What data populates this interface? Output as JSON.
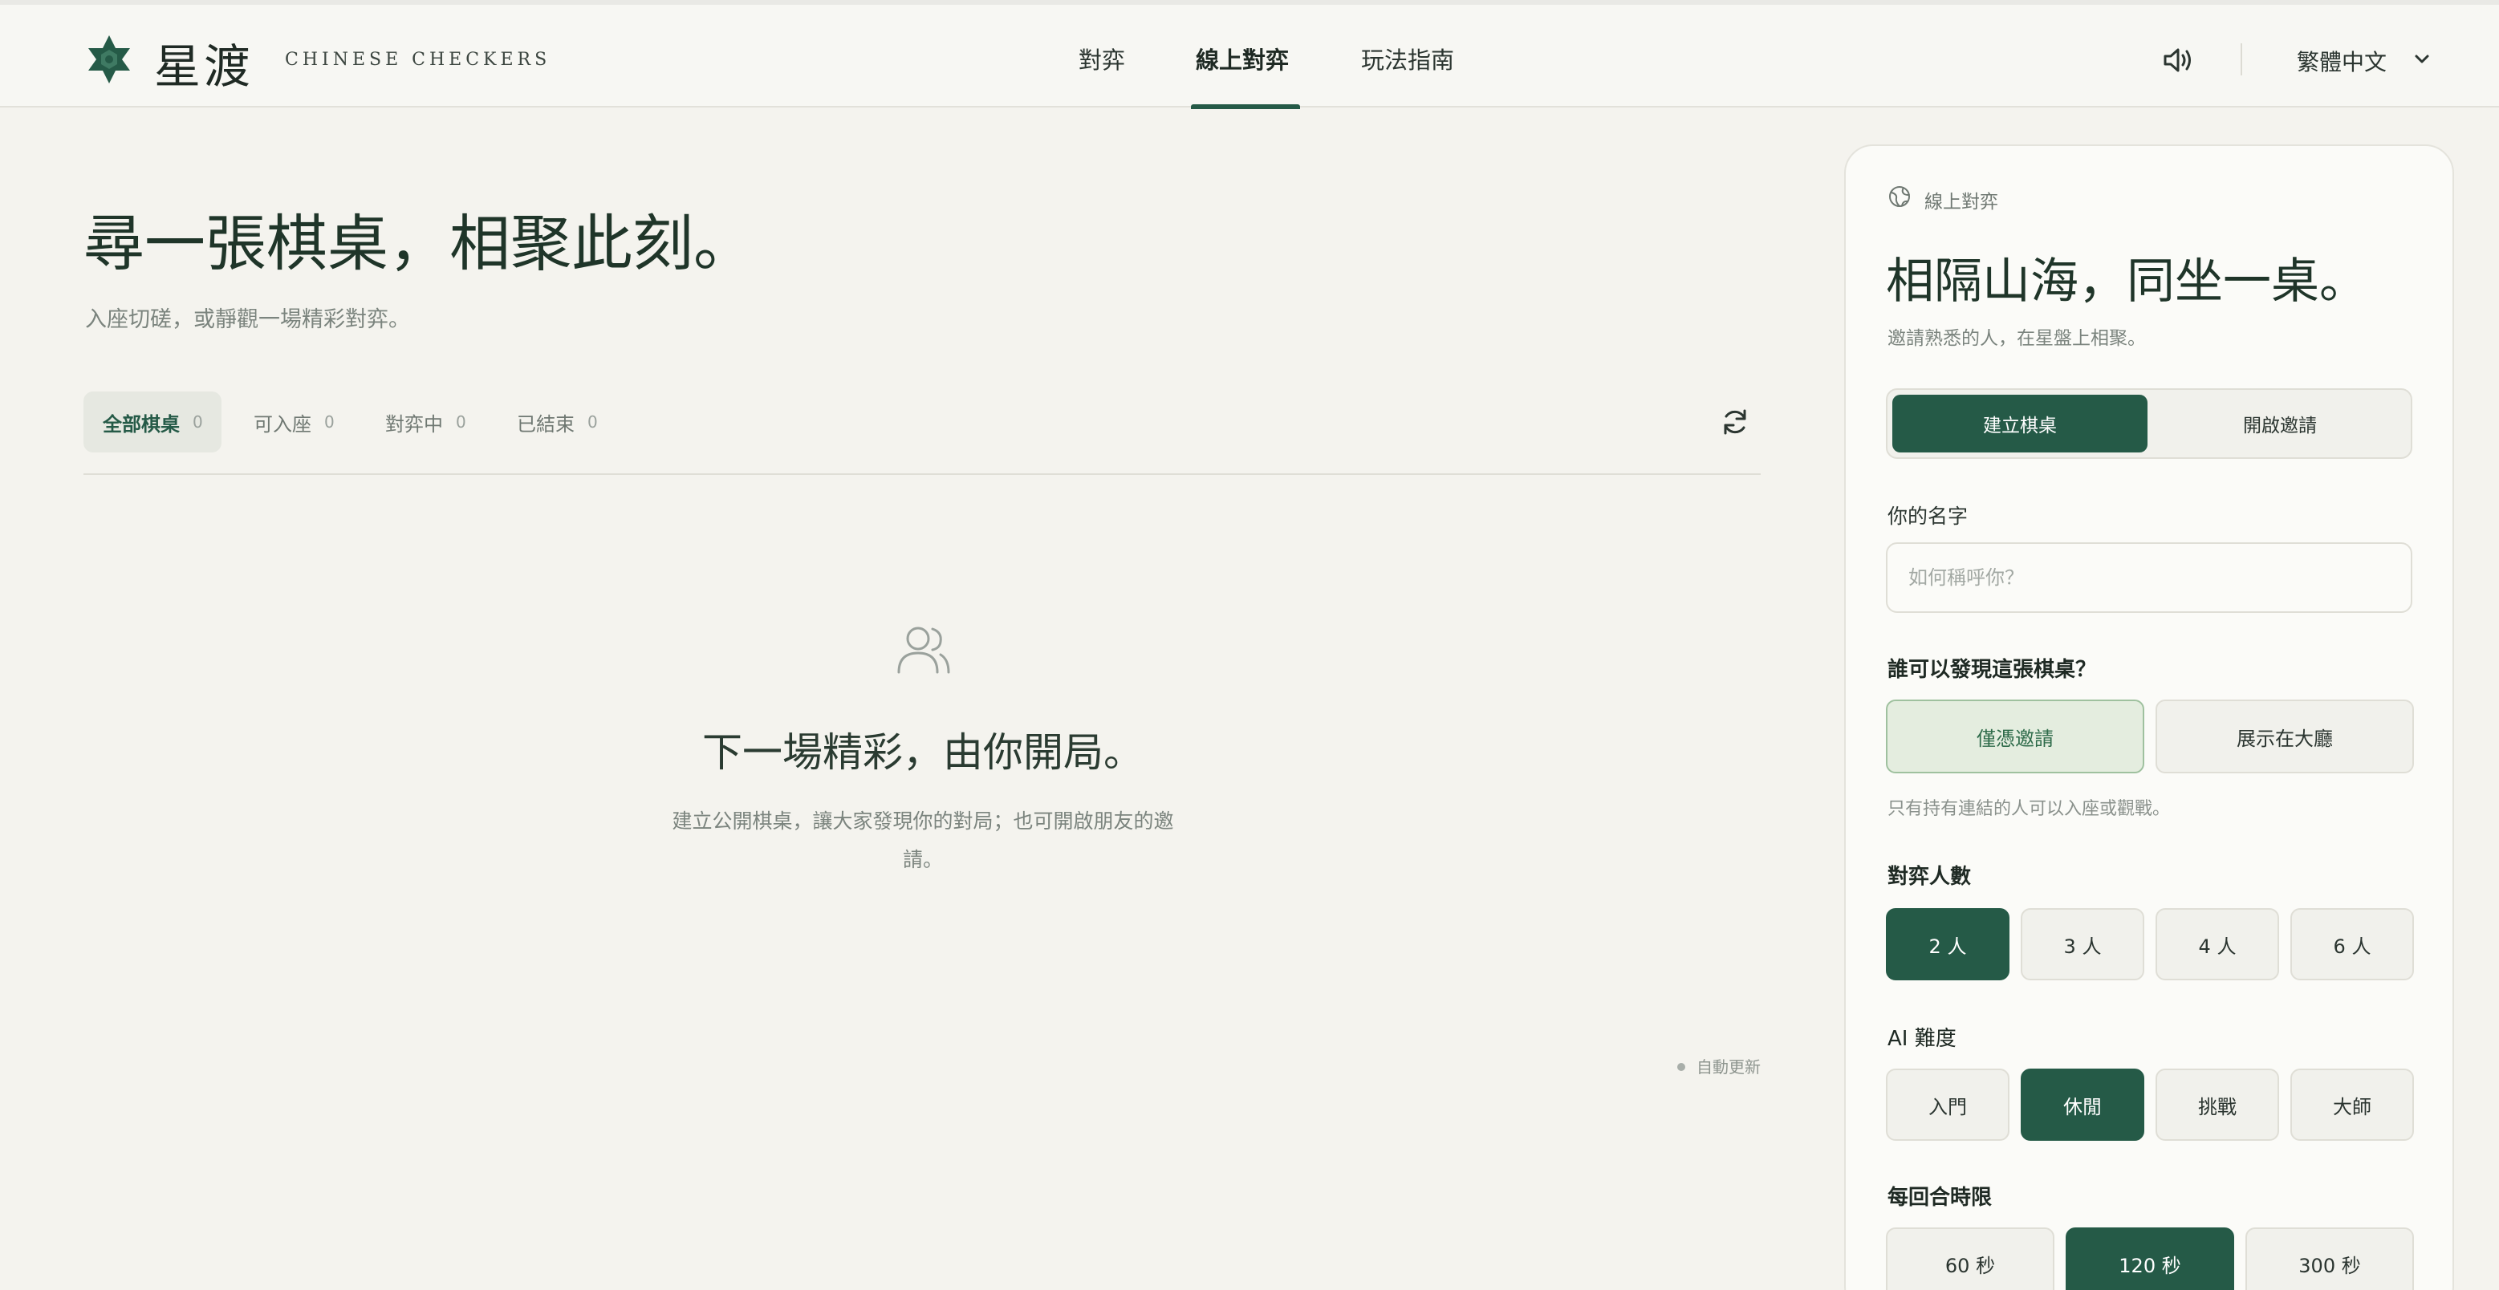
{
  "header": {
    "logo_icon": "star-icon",
    "logo_text": "星渡",
    "logo_sub": "CHINESE CHECKERS",
    "nav": [
      {
        "label": "對弈",
        "active": false
      },
      {
        "label": "線上對弈",
        "active": true
      },
      {
        "label": "玩法指南",
        "active": false
      }
    ],
    "sound_icon": "speaker-icon",
    "language": "繁體中文",
    "language_icon": "chevron-down-icon"
  },
  "main": {
    "title": "尋一張棋桌，相聚此刻。",
    "subtitle": "入座切磋，或靜觀一場精彩對弈。",
    "filters": [
      {
        "label": "全部棋桌",
        "count": "0",
        "active": true
      },
      {
        "label": "可入座",
        "count": "0",
        "active": false
      },
      {
        "label": "對弈中",
        "count": "0",
        "active": false
      },
      {
        "label": "已結束",
        "count": "0",
        "active": false
      }
    ],
    "refresh_icon": "refresh-icon",
    "empty": {
      "icon": "users-icon",
      "title": "下一場精彩，由你開局。",
      "text": "建立公開棋桌，讓大家發現你的對局；也可開啟朋友的邀請。"
    },
    "auto_refresh": "自動更新"
  },
  "panel": {
    "kicker_icon": "globe-icon",
    "kicker": "線上對弈",
    "title": "相隔山海，同坐一桌。",
    "subtitle": "邀請熟悉的人，在星盤上相聚。",
    "mode_tabs": [
      {
        "label": "建立棋桌",
        "active": true
      },
      {
        "label": "開啟邀請",
        "active": false
      }
    ],
    "name_label": "你的名字",
    "name_placeholder": "如何稱呼你？",
    "name_value": "",
    "visibility_label": "誰可以發現這張棋桌？",
    "visibility_options": [
      {
        "label": "僅憑邀請",
        "selected": true
      },
      {
        "label": "展示在大廳",
        "selected": false
      }
    ],
    "visibility_hint": "只有持有連結的人可以入座或觀戰。",
    "players_label": "對弈人數",
    "players_options": [
      {
        "label": "2 人",
        "selected": true
      },
      {
        "label": "3 人",
        "selected": false
      },
      {
        "label": "4 人",
        "selected": false
      },
      {
        "label": "6 人",
        "selected": false
      }
    ],
    "ai_label": "AI 難度",
    "ai_options": [
      {
        "label": "入門",
        "selected": false
      },
      {
        "label": "休閒",
        "selected": true
      },
      {
        "label": "挑戰",
        "selected": false
      },
      {
        "label": "大師",
        "selected": false
      }
    ],
    "time_label": "每回合時限",
    "time_options": [
      {
        "label": "60 秒",
        "selected": false
      },
      {
        "label": "120 秒",
        "selected": true
      },
      {
        "label": "300 秒",
        "selected": false
      }
    ]
  },
  "colors": {
    "accent": "#255a47",
    "background": "#f4f3ee",
    "panel": "#fbfbf8",
    "soft_selected": "#e4eddf"
  }
}
